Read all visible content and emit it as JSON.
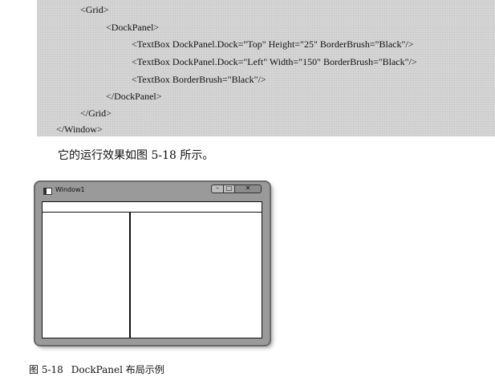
{
  "code": {
    "lines": [
      "<Grid>",
      "<DockPanel>",
      "<TextBox DockPanel.Dock=\"Top\" Height=\"25\" BorderBrush=\"Black\"/>",
      "<TextBox DockPanel.Dock=\"Left\" Width=\"150\" BorderBrush=\"Black\"/>",
      "<TextBox BorderBrush=\"Black\"/>",
      "</DockPanel>",
      "</Grid>",
      "</Window>"
    ]
  },
  "body_text": "它的运行效果如图 5-18 所示。",
  "window": {
    "title": "Window1",
    "minimize_glyph": "–",
    "maximize_glyph": "□",
    "close_glyph": "✕",
    "icons": {
      "system": "window-app-icon",
      "minimize": "minimize-icon",
      "maximize": "maximize-icon",
      "close": "close-icon"
    }
  },
  "caption": {
    "number": "图 5-18",
    "text": "DockPanel 布局示例"
  },
  "colors": {
    "code_background": "#d6d6d6",
    "window_frame": "#9a9a9a",
    "text": "#111111"
  }
}
